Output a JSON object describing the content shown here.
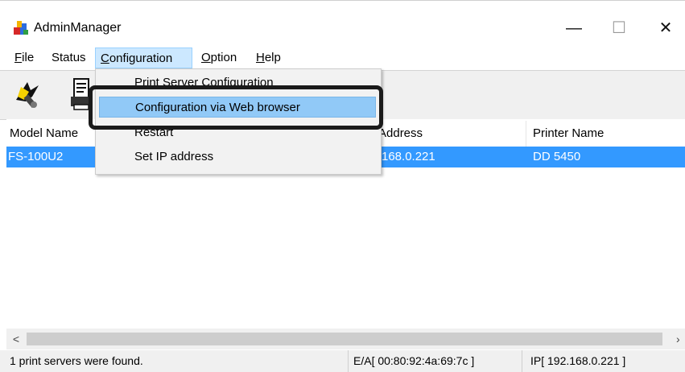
{
  "window": {
    "title": "AdminManager",
    "controls": {
      "minimize": "—",
      "maximize": "☐",
      "close": "✕"
    }
  },
  "menubar": {
    "items": [
      {
        "mnemonic": "F",
        "rest": "ile"
      },
      {
        "mnemonic": "S",
        "rest": "tatus",
        "mnemonic_pos": 1
      },
      {
        "mnemonic": "C",
        "rest": "onfiguration"
      },
      {
        "mnemonic": "O",
        "rest": "ption"
      },
      {
        "mnemonic": "H",
        "rest": "elp"
      }
    ]
  },
  "toolbar": {
    "buttons": [
      {
        "icon": "search-network-icon"
      },
      {
        "icon": "printer-list-icon"
      }
    ]
  },
  "list": {
    "columns": [
      "Model Name",
      "Address",
      "Printer Name"
    ],
    "rows": [
      {
        "model": "FS-100U2",
        "address": "168.0.221",
        "printer": "DD 5450",
        "selected": true
      }
    ]
  },
  "dropdown": {
    "items": [
      "Print Server Configuration",
      "Configuration via Web browser",
      "Restart",
      "Set IP address"
    ],
    "highlighted_index": 1
  },
  "scrollbar": {
    "left_arrow": "<",
    "right_arrow": "›"
  },
  "statusbar": {
    "message": "1 print servers were found.",
    "mac": "E/A[ 00:80:92:4a:69:7c ]",
    "ip": "IP[ 192.168.0.221 ]"
  },
  "colors": {
    "selection": "#3399ff",
    "menu_highlight": "#91c9f7",
    "callout_frame": "#1a1a1a"
  }
}
